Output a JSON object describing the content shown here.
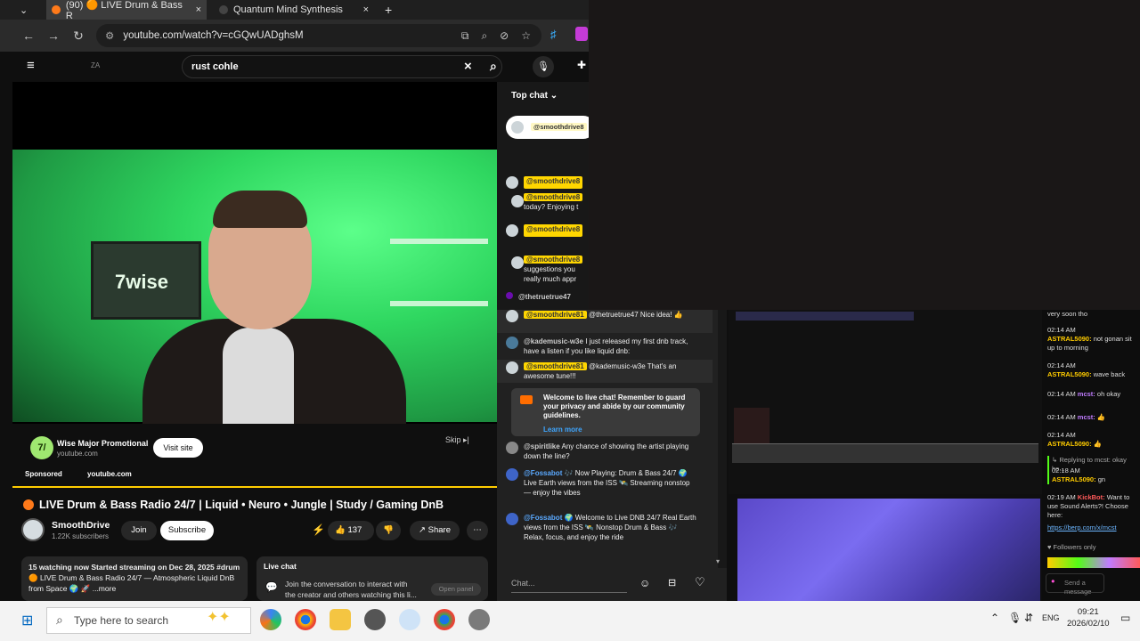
{
  "tabs": [
    {
      "label": "(90) 🟠 LIVE Drum & Bass R",
      "close": "×"
    },
    {
      "label": "Quantum Mind Synthesis",
      "close": "×"
    }
  ],
  "new_tab": "+",
  "url": "youtube.com/watch?v=cGQwUADghsM",
  "yt": {
    "search_value": "rust cohle",
    "clear": "×",
    "badge": "ZA"
  },
  "ad": {
    "advertiser": "Wise Major Promotional",
    "domain": "youtube.com",
    "visit": "Visit site",
    "skip": "Skip",
    "sponsored": "Sponsored",
    "sponsor_domain": "youtube.com",
    "logo_text": "7/"
  },
  "video": {
    "title": "LIVE Drum & Bass Radio 24/7 | Liquid • Neuro • Jungle | Study / Gaming DnB",
    "brand_on_monitor": "7wise",
    "channel": "SmoothDrive",
    "subscribers": "1.22K subscribers",
    "join": "Join",
    "subscribe": "Subscribe",
    "likes": "137",
    "share": "Share",
    "more": "⋯"
  },
  "description": {
    "line1": "15 watching now  Started streaming on Dec 28, 2025  #drum",
    "line2": "🟠 LIVE Drum & Bass Radio 24/7 — Atmospheric Liquid DnB",
    "line3": "from Space 🌍 🚀  ...more"
  },
  "livechat_card": {
    "title": "Live chat",
    "text1": "Join the conversation to interact with",
    "text2": "the creator and others watching this li...",
    "button": "Open panel"
  },
  "chat": {
    "header": "Top chat",
    "pinned": "@smoothdrive8",
    "messages": [
      {
        "user": "@smoothdrive8",
        "text": ""
      },
      {
        "user": "@smoothdrive8",
        "text": "today? Enjoying t"
      },
      {
        "user": "@smoothdrive8",
        "text": ""
      },
      {
        "user": "@smoothdrive8",
        "text": "suggestions you"
      },
      {
        "user": "",
        "text": "really much appr"
      },
      {
        "user": "@thetruetrue47",
        "text": ""
      }
    ],
    "messages2": [
      {
        "user": "@smoothdrive81",
        "text": "@thetruetrue47 Nice idea! 👍"
      },
      {
        "user": "@kademusic-w3e",
        "text": "I just released my first dnb track, have a listen if you like liquid dnb:"
      },
      {
        "user": "@smoothdrive81",
        "text": "@kademusic-w3e That's an awesome tune!!!"
      },
      {
        "user": "@spiritlike",
        "text": "Any chance of showing the artist playing down the line?"
      },
      {
        "user": "@Fossabot",
        "text": "🎶 Now Playing: Drum & Bass 24/7 🌍 Live Earth views from the ISS 🛰️ Streaming nonstop — enjoy the vibes"
      },
      {
        "user": "@Fossabot",
        "text": "🌍 Welcome to Live DNB 24/7 Real Earth views from the ISS 🛰️ Nonstop Drum & Bass 🎶 Relax, focus, and enjoy the ride"
      }
    ],
    "welcome": "Welcome to live chat! Remember to guard your privacy and abide by our community guidelines.",
    "learn_more": "Learn more",
    "input_placeholder": "Chat..."
  },
  "kick": {
    "lines": [
      {
        "time": "",
        "user": "",
        "text": "very soon tho"
      },
      {
        "time": "02:14 AM",
        "user": "ASTRAL5090:",
        "text": "not gonan sit up to morning"
      },
      {
        "time": "02:14 AM",
        "user": "ASTRAL5090:",
        "text": "wave back"
      },
      {
        "time": "02:14 AM",
        "user": "mcst:",
        "text": "oh okay"
      },
      {
        "time": "02:14 AM",
        "user": "mcst:",
        "text": "👍"
      },
      {
        "time": "02:14 AM",
        "user": "ASTRAL5090:",
        "text": "👍"
      },
      {
        "time": "",
        "user": "",
        "text": "↳ Replying to mcst: okay he..."
      },
      {
        "time": "02:18 AM",
        "user": "ASTRAL5090:",
        "text": "gn"
      },
      {
        "time": "02:19 AM",
        "user": "KickBot:",
        "text": "Want to use Sound Alerts?! Choose here:"
      },
      {
        "time": "",
        "user": "",
        "text": "https://berp.com/x/mcst"
      }
    ],
    "followers_only": "♥ Followers only",
    "send": "Send a message"
  },
  "taskbar": {
    "search": "Type here to search",
    "time": "09:21",
    "date": "2026/02/10",
    "lang": "ENG"
  },
  "colors": {
    "yt_red": "#ff0000",
    "kick_green": "#53fc18",
    "bg": "#0f0f0f"
  }
}
